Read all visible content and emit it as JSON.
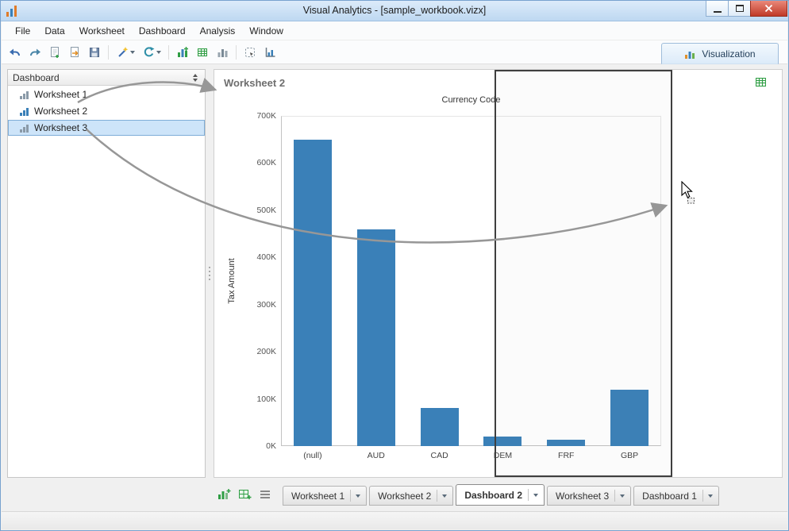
{
  "window": {
    "title": "Visual Analytics - [sample_workbook.vizx]"
  },
  "menu": {
    "items": [
      {
        "label": "File"
      },
      {
        "label": "Data"
      },
      {
        "label": "Worksheet"
      },
      {
        "label": "Dashboard"
      },
      {
        "label": "Analysis"
      },
      {
        "label": "Window"
      }
    ]
  },
  "toolbar": {
    "icons": [
      "undo",
      "redo",
      "new-document",
      "open",
      "save",
      "wizard",
      "refresh",
      "add-graph",
      "add-table",
      "bar-chart",
      "marquee-select",
      "axes"
    ],
    "visualization_tab_label": "Visualization"
  },
  "sidebar": {
    "header_label": "Dashboard",
    "items": [
      {
        "label": "Worksheet 1",
        "selected": false,
        "icon": "bar-chart-icon",
        "icon_color": "#8a9aa8"
      },
      {
        "label": "Worksheet 2",
        "selected": false,
        "icon": "bar-chart-icon",
        "icon_color": "#3a80b8"
      },
      {
        "label": "Worksheet 3",
        "selected": true,
        "icon": "bar-chart-icon",
        "icon_color": "#8a9aa8"
      }
    ]
  },
  "panel": {
    "title": "Worksheet 2"
  },
  "chart_data": {
    "type": "bar",
    "title": "Currency Code",
    "categories": [
      "(null)",
      "AUD",
      "CAD",
      "DEM",
      "FRF",
      "GBP"
    ],
    "values": [
      650000,
      460000,
      80000,
      20000,
      14000,
      120000
    ],
    "xlabel": "",
    "ylabel": "Tax Amount",
    "ylim": [
      0,
      700000
    ],
    "ytick_labels": [
      "0K",
      "100K",
      "200K",
      "300K",
      "400K",
      "500K",
      "600K",
      "700K"
    ],
    "grid": false,
    "legend": false,
    "bar_color": "#3a80b8"
  },
  "tabstrip": {
    "tabs": [
      {
        "label": "Worksheet 1",
        "active": false
      },
      {
        "label": "Worksheet 2",
        "active": false
      },
      {
        "label": "Dashboard 2",
        "active": true
      },
      {
        "label": "Worksheet 3",
        "active": false
      },
      {
        "label": "Dashboard 1",
        "active": false
      }
    ]
  },
  "colors": {
    "accent_blue": "#3a80b8",
    "selection_bg": "#cde4f9",
    "selection_border": "#7eadd8",
    "titlebar": "#c9dcf3",
    "close_button": "#c8402e",
    "green": "#2f9e44",
    "arrow_gray": "#999999"
  }
}
